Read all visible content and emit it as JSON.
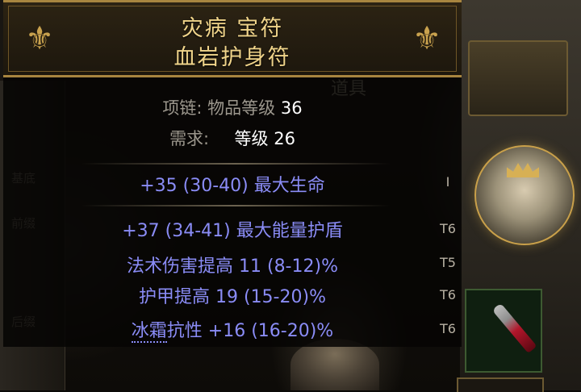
{
  "item": {
    "header_line1": "灾病 宝符",
    "header_line2": "血岩护身符"
  },
  "properties": {
    "item_level_label": "项链: 物品等级",
    "item_level_value": "36",
    "requires_label": "需求:",
    "requires_level_label": "等级",
    "requires_level_value": "26"
  },
  "implicit": {
    "text": "+35 (30-40) 最大生命",
    "tier": "I"
  },
  "explicit_mods": [
    {
      "text": "+37 (34-41) 最大能量护盾",
      "tier": "T6"
    },
    {
      "text": "法术伤害提高 11 (8-12)%",
      "tier": "T5"
    },
    {
      "text": "护甲提高 19 (15-20)%",
      "tier": "T6"
    },
    {
      "text_prefix": "冰霜",
      "text_rest": "抗性 +16 (16-20)%",
      "tier": "T6"
    }
  ],
  "background": {
    "panel_title": "道具",
    "side_labels": [
      "基底",
      "前缀",
      "后缀"
    ]
  },
  "colors": {
    "header_gold": "#f0d48a",
    "mod_blue": "#8a8cf6",
    "label_grey": "#9c978d"
  }
}
